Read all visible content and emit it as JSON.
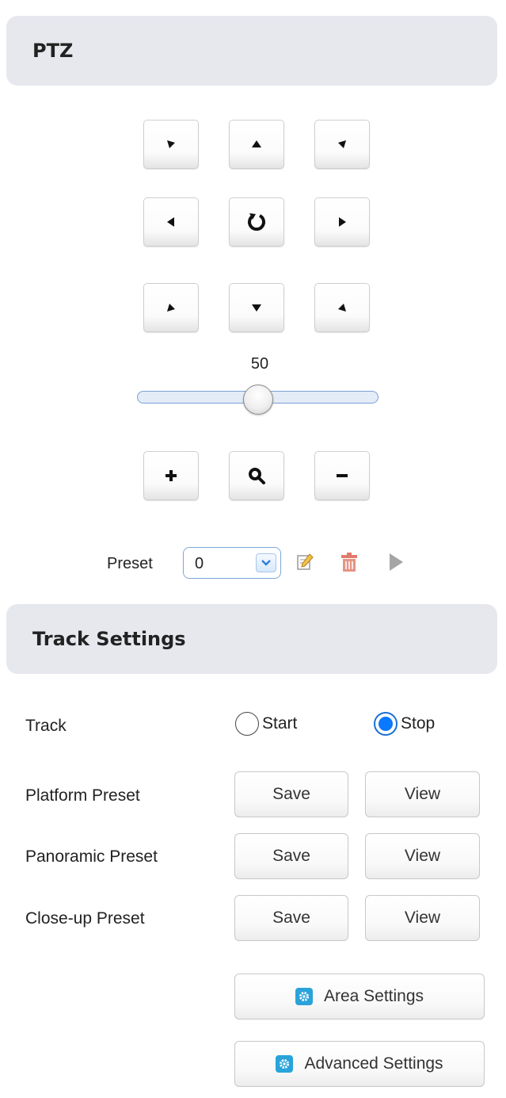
{
  "ptz": {
    "title": "PTZ",
    "speed_value": "50",
    "speed_fraction": 0.5,
    "buttons": [
      {
        "name": "pan-up-left-button",
        "icon": "arrow-up-left-icon"
      },
      {
        "name": "tilt-up-button",
        "icon": "arrow-up-icon"
      },
      {
        "name": "pan-up-right-button",
        "icon": "arrow-up-right-icon"
      },
      {
        "name": "pan-left-button",
        "icon": "arrow-left-icon"
      },
      {
        "name": "reset-position-button",
        "icon": "rotate-icon"
      },
      {
        "name": "pan-right-button",
        "icon": "arrow-right-icon"
      },
      {
        "name": "pan-down-left-button",
        "icon": "arrow-down-left-icon"
      },
      {
        "name": "tilt-down-button",
        "icon": "arrow-down-icon"
      },
      {
        "name": "pan-down-right-button",
        "icon": "arrow-down-right-icon"
      }
    ],
    "zoom_buttons": [
      {
        "name": "zoom-in-button",
        "icon": "plus-icon"
      },
      {
        "name": "zoom-search-button",
        "icon": "magnifier-icon"
      },
      {
        "name": "zoom-out-button",
        "icon": "minus-icon"
      }
    ],
    "preset": {
      "label": "Preset",
      "value": "0",
      "icons": [
        "edit-icon",
        "delete-icon",
        "play-icon"
      ]
    }
  },
  "track": {
    "title": "Track Settings",
    "track_label": "Track",
    "options": [
      {
        "label": "Start",
        "checked": false
      },
      {
        "label": "Stop",
        "checked": true
      }
    ],
    "rows": [
      {
        "label": "Platform Preset",
        "save": "Save",
        "view": "View"
      },
      {
        "label": "Panoramic Preset",
        "save": "Save",
        "view": "View"
      },
      {
        "label": "Close-up Preset",
        "save": "Save",
        "view": "View"
      }
    ],
    "area_settings": "Area Settings",
    "advanced_settings": "Advanced Settings",
    "accent_color": "#2aa3da",
    "radio_color": "#0a78ff"
  }
}
